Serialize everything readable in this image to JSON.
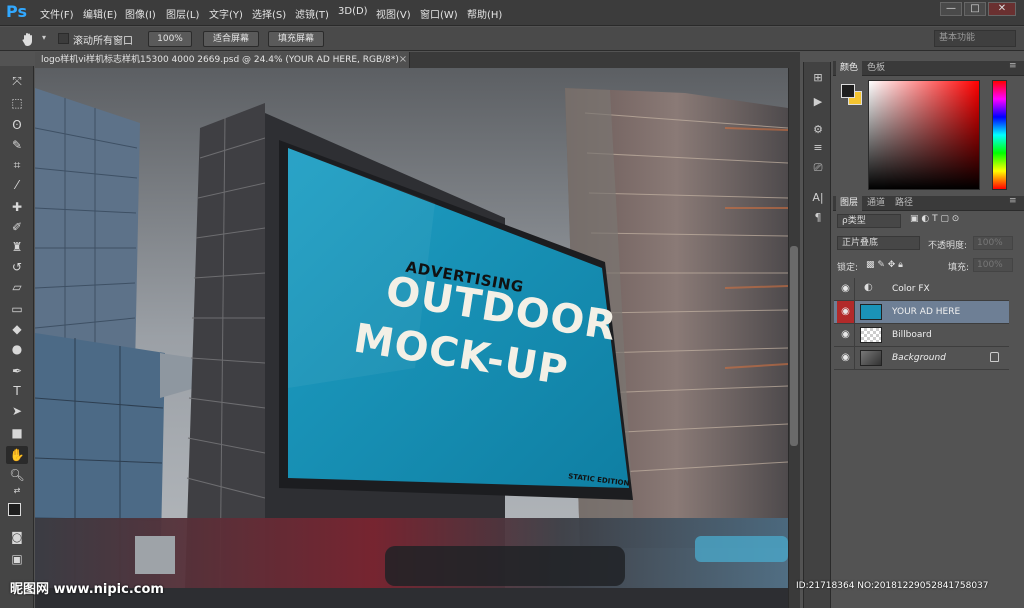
{
  "app": {
    "logo": "Ps"
  },
  "menus": [
    "文件(F)",
    "编辑(E)",
    "图像(I)",
    "图层(L)",
    "文字(Y)",
    "选择(S)",
    "滤镜(T)",
    "3D(D)",
    "视图(V)",
    "窗口(W)",
    "帮助(H)"
  ],
  "window_buttons": {
    "minimize": "—",
    "restore": "□",
    "close": "✕"
  },
  "options": {
    "scroll_all_label": "滚动所有窗口",
    "zoom_100": "100%",
    "fit_screen": "适合屏幕",
    "fill_screen": "填充屏幕",
    "workspace": "基本功能"
  },
  "document": {
    "tab_title": "logo样机vi样机标志样机15300 4000 2669.psd @ 24.4% (YOUR AD HERE, RGB/8*)",
    "tab_close": "×"
  },
  "billboard": {
    "small_heading": "ADVERTISING",
    "headline_line1": "OUTDOOR",
    "headline_line2": "MOCK-UP",
    "edition": "STATIC EDITION",
    "screen_color": "#1a93b8"
  },
  "color_panel": {
    "tabs": [
      "颜色",
      "色板"
    ],
    "foreground": "#1e1e1e",
    "background": "#f4c430"
  },
  "layers_panel": {
    "tabs": [
      "图层",
      "通道",
      "路径"
    ],
    "filter_kind": "ρ类型",
    "blend_mode": "正片叠底",
    "opacity_label": "不透明度:",
    "opacity_value": "100%",
    "lock_label": "锁定:",
    "fill_label": "填充:",
    "fill_value": "100%",
    "layers": [
      {
        "name": "Color FX",
        "selected": false
      },
      {
        "name": "YOUR AD HERE",
        "selected": true
      },
      {
        "name": "Billboard",
        "selected": false
      },
      {
        "name": "Background",
        "selected": false,
        "locked": true
      }
    ]
  },
  "watermark": {
    "left": "昵图网 www.nipic.com",
    "right": "ID:21718364 NO:20181229052841758037"
  }
}
